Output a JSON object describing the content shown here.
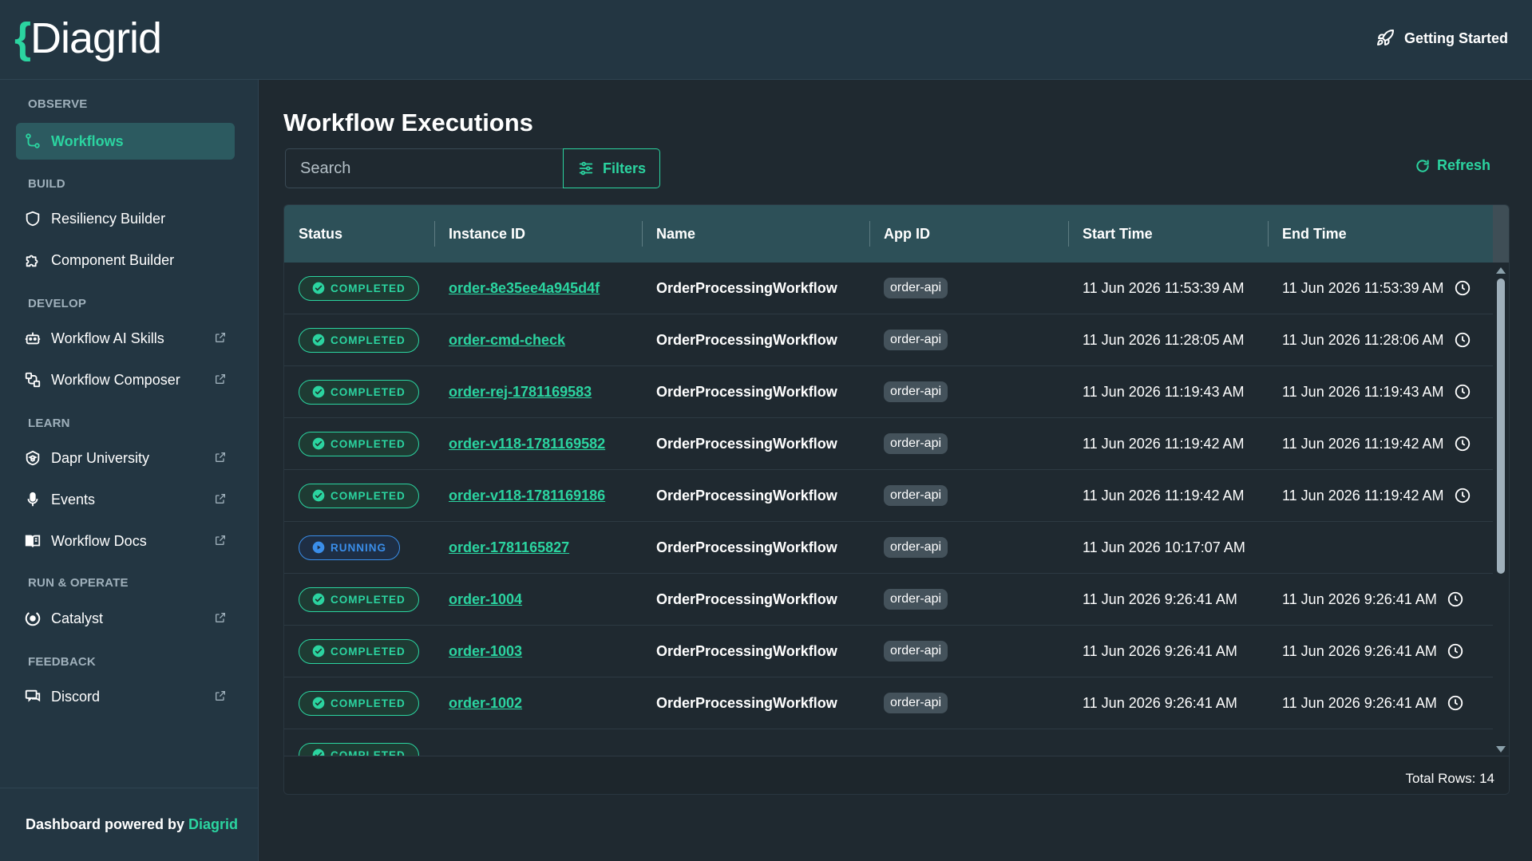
{
  "header": {
    "logo_brace": "{",
    "logo_text": "Diagrid",
    "getting_started": "Getting Started"
  },
  "sidebar": {
    "sections": {
      "observe": "OBSERVE",
      "build": "BUILD",
      "develop": "DEVELOP",
      "learn": "LEARN",
      "run_operate": "RUN & OPERATE",
      "feedback": "FEEDBACK"
    },
    "items": {
      "workflows": "Workflows",
      "resiliency_builder": "Resiliency Builder",
      "component_builder": "Component Builder",
      "workflow_ai_skills": "Workflow AI Skills",
      "workflow_composer": "Workflow Composer",
      "dapr_university": "Dapr University",
      "events": "Events",
      "workflow_docs": "Workflow Docs",
      "catalyst": "Catalyst",
      "discord": "Discord"
    },
    "footer": {
      "text": "Dashboard powered by",
      "brand": "Diagrid"
    }
  },
  "main": {
    "title": "Workflow Executions",
    "search_placeholder": "Search",
    "filters_label": "Filters",
    "refresh_label": "Refresh",
    "columns": {
      "status": "Status",
      "instance_id": "Instance ID",
      "name": "Name",
      "app_id": "App ID",
      "start_time": "Start Time",
      "end_time": "End Time"
    },
    "rows": [
      {
        "status": "COMPLETED",
        "id": "order-8e35ee4a945d4f",
        "name": "OrderProcessingWorkflow",
        "app": "order-api",
        "start": "11 Jun 2026 11:53:39 AM",
        "end": "11 Jun 2026 11:53:39 AM"
      },
      {
        "status": "COMPLETED",
        "id": "order-cmd-check",
        "name": "OrderProcessingWorkflow",
        "app": "order-api",
        "start": "11 Jun 2026 11:28:05 AM",
        "end": "11 Jun 2026 11:28:06 AM"
      },
      {
        "status": "COMPLETED",
        "id": "order-rej-1781169583",
        "name": "OrderProcessingWorkflow",
        "app": "order-api",
        "start": "11 Jun 2026 11:19:43 AM",
        "end": "11 Jun 2026 11:19:43 AM"
      },
      {
        "status": "COMPLETED",
        "id": "order-v118-1781169582",
        "name": "OrderProcessingWorkflow",
        "app": "order-api",
        "start": "11 Jun 2026 11:19:42 AM",
        "end": "11 Jun 2026 11:19:42 AM"
      },
      {
        "status": "COMPLETED",
        "id": "order-v118-1781169186",
        "name": "OrderProcessingWorkflow",
        "app": "order-api",
        "start": "11 Jun 2026 11:19:42 AM",
        "end": "11 Jun 2026 11:19:42 AM"
      },
      {
        "status": "RUNNING",
        "id": "order-1781165827",
        "name": "OrderProcessingWorkflow",
        "app": "order-api",
        "start": "11 Jun 2026 10:17:07 AM",
        "end": ""
      },
      {
        "status": "COMPLETED",
        "id": "order-1004",
        "name": "OrderProcessingWorkflow",
        "app": "order-api",
        "start": "11 Jun 2026 9:26:41 AM",
        "end": "11 Jun 2026 9:26:41 AM"
      },
      {
        "status": "COMPLETED",
        "id": "order-1003",
        "name": "OrderProcessingWorkflow",
        "app": "order-api",
        "start": "11 Jun 2026 9:26:41 AM",
        "end": "11 Jun 2026 9:26:41 AM"
      },
      {
        "status": "COMPLETED",
        "id": "order-1002",
        "name": "OrderProcessingWorkflow",
        "app": "order-api",
        "start": "11 Jun 2026 9:26:41 AM",
        "end": "11 Jun 2026 9:26:41 AM"
      },
      {
        "status": "COMPLETED",
        "id": "",
        "name": "",
        "app": "",
        "start": "",
        "end": ""
      }
    ],
    "total_rows": "Total Rows: 14"
  },
  "colors": {
    "accent": "#2bd4a0",
    "running": "#3a8eea",
    "sidebar_bg": "#233642",
    "main_bg": "#1f2930",
    "header_row": "#2d5058"
  },
  "icons": {
    "getting_started": "rocket-icon",
    "workflows": "workflow-nodes-icon",
    "resiliency_builder": "shield-icon",
    "component_builder": "puzzle-icon",
    "workflow_ai_skills": "robot-icon",
    "workflow_composer": "composer-icon",
    "dapr_university": "university-icon",
    "events": "microphone-icon",
    "workflow_docs": "book-icon",
    "catalyst": "catalyst-icon",
    "discord": "chat-icon",
    "external": "external-link-icon",
    "filters": "sliders-icon",
    "refresh": "refresh-icon",
    "completed": "check-circle-icon",
    "running": "play-circle-icon",
    "end_time": "clock-icon"
  }
}
